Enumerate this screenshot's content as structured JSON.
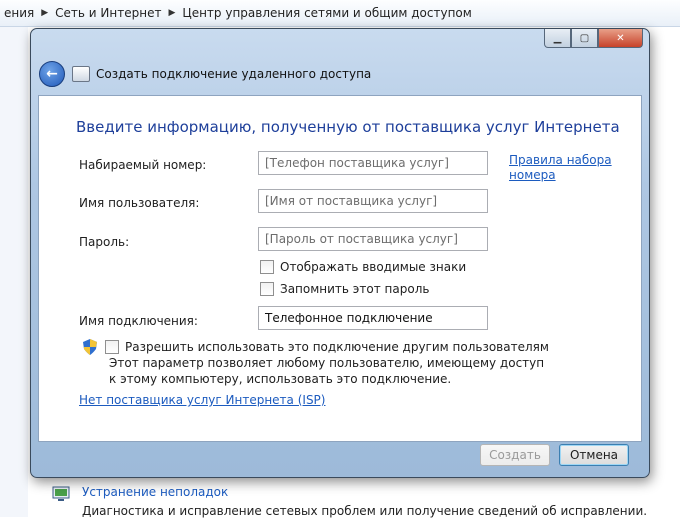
{
  "background": {
    "breadcrumb": [
      "ения",
      "Сеть и Интернет",
      "Центр управления сетями и общим доступом"
    ],
    "troubleshoot_link": "Устранение неполадок",
    "troubleshoot_desc": "Диагностика и исправление сетевых проблем или получение сведений об исправлении."
  },
  "dialog": {
    "title": "Создать подключение удаленного доступа",
    "heading": "Введите информацию, полученную от поставщика услуг Интернета",
    "fields": {
      "phone_label": "Набираемый номер:",
      "phone_placeholder": "[Телефон поставщика услуг]",
      "dialing_rules_line1": "Правила набора",
      "dialing_rules_line2": "номера",
      "username_label": "Имя пользователя:",
      "username_placeholder": "[Имя от поставщика услуг]",
      "password_label": "Пароль:",
      "password_placeholder": "[Пароль от поставщика услуг]",
      "show_chars": "Отображать вводимые знаки",
      "remember_password": "Запомнить этот пароль",
      "connection_name_label": "Имя подключения:",
      "connection_name_value": "Телефонное подключение"
    },
    "allow_others": "Разрешить использовать это подключение другим пользователям",
    "allow_hint": "Этот параметр позволяет любому пользователю, имеющему доступ к этому компьютеру, использовать это подключение.",
    "no_isp_link": "Нет поставщика услуг Интернета (ISP)",
    "buttons": {
      "create": "Создать",
      "cancel": "Отмена"
    }
  },
  "colors": {
    "heading": "#1e3f9a",
    "link": "#1c5bbf",
    "frame": "#aec7e3"
  }
}
